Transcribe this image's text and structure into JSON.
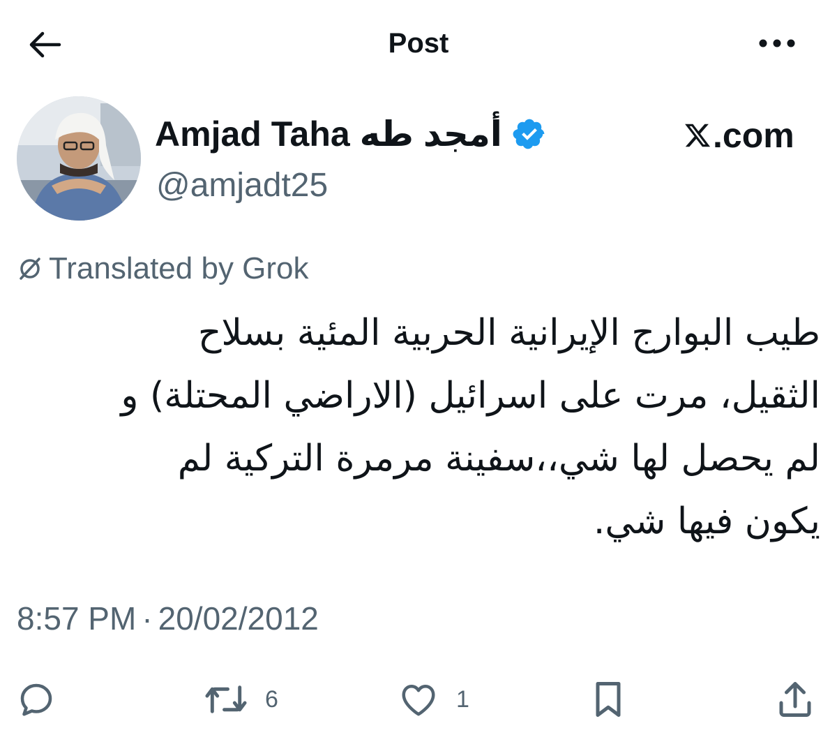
{
  "header": {
    "title": "Post",
    "back_icon": "arrow-left-icon",
    "more_icon": "more-horizontal-icon"
  },
  "author": {
    "display_name": "Amjad Taha أمجد طه",
    "handle": "@amjadt25",
    "verified": true,
    "verified_color": "#1d9bf0",
    "avatar_icon": "profile-photo"
  },
  "watermark": {
    "text": ".com",
    "logo_icon": "x-logo-icon"
  },
  "translation": {
    "label": "Translated by Grok",
    "icon": "grok-icon"
  },
  "tweet": {
    "lines": [
      "طيب البوارج الإيرانية الحربية المئية بسلاح",
      "الثقيل، مرت على اسرائيل (الاراضي المحتلة) و",
      "لم يحصل لها شي،،سفينة مرمرة التركية لم",
      "يكون فيها شي."
    ]
  },
  "meta": {
    "time": "8:57 PM",
    "separator": "·",
    "date": "20/02/2012"
  },
  "actions": {
    "reply": {
      "icon": "reply-icon",
      "count": ""
    },
    "repost": {
      "icon": "repost-icon",
      "count": "6"
    },
    "like": {
      "icon": "heart-icon",
      "count": "1"
    },
    "bookmark": {
      "icon": "bookmark-icon",
      "count": ""
    },
    "share": {
      "icon": "share-icon",
      "count": ""
    }
  },
  "colors": {
    "text": "#0f1419",
    "secondary": "#536471",
    "accent": "#1d9bf0"
  }
}
